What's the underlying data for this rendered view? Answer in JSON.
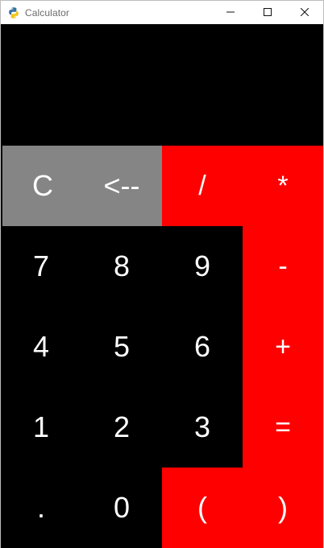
{
  "window": {
    "title": "Calculator",
    "icon": "python-icon",
    "controls": {
      "minimize": "minimize-icon",
      "maximize": "maximize-icon",
      "close": "close-icon"
    }
  },
  "display": {
    "value": ""
  },
  "buttons": {
    "clear": "C",
    "backspace": "<--",
    "divide": "/",
    "multiply": "*",
    "seven": "7",
    "eight": "8",
    "nine": "9",
    "minus": "-",
    "four": "4",
    "five": "5",
    "six": "6",
    "plus": "+",
    "one": "1",
    "two": "2",
    "three": "3",
    "equals": "=",
    "dot": ".",
    "zero": "0",
    "open_paren": "(",
    "close_paren": ")"
  },
  "colors": {
    "gray": "#858585",
    "red": "#ff0000",
    "black": "#000000",
    "white": "#ffffff"
  }
}
